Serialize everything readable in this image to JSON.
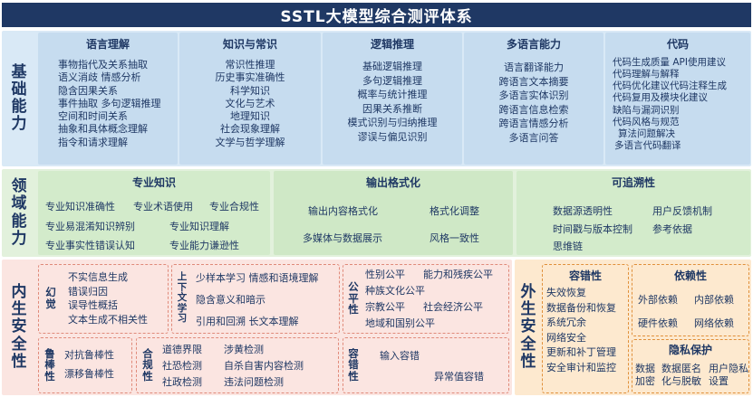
{
  "title": "SSTL大模型综合测评体系",
  "rows": {
    "basic": {
      "label": [
        "基",
        "础",
        "能",
        "力"
      ],
      "panels": [
        {
          "title": "语言理解",
          "items": [
            "事物指代及关系抽取",
            "语义消歧   情感分析",
            "隐含因果关系",
            "事件抽取  多句逻辑推理",
            "空间和时间关系",
            "抽象和具体概念理解",
            "指令和请求理解"
          ]
        },
        {
          "title": "知识与常识",
          "items": [
            "常识性推理",
            "历史事实准确性",
            "科学知识",
            "文化与艺术",
            "地理知识",
            "社会现象理解",
            "文学与哲学理解"
          ]
        },
        {
          "title": "逻辑推理",
          "items": [
            "基础逻辑推理",
            "多句逻辑推理",
            "概率与统计推理",
            "因果关系推断",
            "模式识别与归纳推理",
            "谬误与偏见识别"
          ]
        },
        {
          "title": "多语言能力",
          "items": [
            "语言翻译能力",
            "跨语言文本摘要",
            "多语言实体识别",
            "跨语言信息检索",
            "跨语言情感分析",
            "多语言问答"
          ]
        },
        {
          "title": "代码",
          "items": [
            "代码生成质量  API使用建议",
            "代码理解与解释",
            "代码优化建议代码注释生成",
            "代码复用及模块化建议",
            "缺陷与漏洞识别",
            "代码风格与规范",
            "算法问题解决",
            "多语言代码翻译"
          ]
        }
      ]
    },
    "domain": {
      "label": [
        "领",
        "域",
        "能",
        "力"
      ],
      "panels": [
        {
          "title": "专业知识",
          "items": [
            "专业知识准确性",
            "专业术语使用",
            "专业合规性",
            "专业易混淆知识辨别",
            "专业知识理解",
            "专业事实性错误认知",
            "专业能力谦逊性"
          ]
        },
        {
          "title": "输出格式化",
          "items": [
            "输出内容格式化",
            "格式化调整",
            "多媒体与数据展示",
            "风格一致性"
          ]
        },
        {
          "title": "可追溯性",
          "items": [
            "数据源透明性",
            "用户反馈机制",
            "时间戳与版本控制",
            "参考依据",
            "思维链"
          ]
        }
      ]
    },
    "intrinsic": {
      "label": [
        "内",
        "生",
        "安",
        "全",
        "性"
      ],
      "hallucination": {
        "label": [
          "幻",
          "觉"
        ],
        "items": [
          "不实信息生成",
          "错误归因",
          "误导性概括",
          "文本生成不相关性"
        ]
      },
      "context": {
        "label": [
          "上",
          "下",
          "文",
          "学",
          "习"
        ],
        "items": [
          "少样本学习  情感和语境理解",
          "隐含意义和暗示",
          "引用和回溯  长文本理解"
        ]
      },
      "fairness": {
        "label": [
          "公",
          "平",
          "性"
        ],
        "items": [
          "性别公平",
          "能力和残疾公平",
          "种族文化公平",
          "宗教公平",
          "社会经济公平",
          "地域和国别公平"
        ]
      },
      "robustness": {
        "label": [
          "鲁",
          "棒",
          "性"
        ],
        "items": [
          "对抗鲁棒性",
          "漂移鲁棒性"
        ]
      },
      "compliance": {
        "label": [
          "合",
          "规",
          "性"
        ],
        "items": [
          "道德界限",
          "涉黄检测",
          "社恐检测",
          "自杀自害内容检测",
          "社政检测",
          "违法问题检测"
        ]
      },
      "fault": {
        "label": [
          "容",
          "错",
          "性"
        ],
        "items": [
          "输入容错",
          "异常值容错"
        ]
      }
    },
    "extrinsic": {
      "label": [
        "外",
        "生",
        "安",
        "全",
        "性"
      ],
      "fault_tolerance": {
        "title": "容错性",
        "items": [
          "失效恢复",
          "数据备份和恢复",
          "系统冗余",
          "网络安全",
          "更新和补丁管理",
          "安全审计和监控"
        ]
      },
      "dependency": {
        "title": "依赖性",
        "items": [
          "外部依赖",
          "内部依赖",
          "硬件依赖",
          "网络依赖"
        ]
      },
      "privacy": {
        "title": "隐私保护",
        "items": [
          "数据加密",
          "数据匿名化与脱敏",
          "用户隐私设置"
        ]
      }
    }
  },
  "colors": {
    "title_bg": "#1f3864",
    "basic_bg": "#d6e8f5",
    "domain_bg": "#dff0d8",
    "intrinsic_bg": "#fbe4e0",
    "extrinsic_bg": "#fde8cc"
  }
}
